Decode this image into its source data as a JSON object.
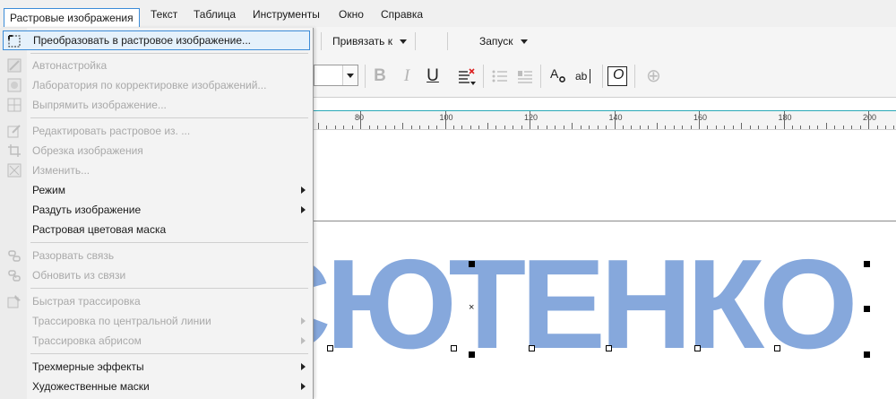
{
  "menubar": {
    "items": [
      {
        "label": "Растровые изображения",
        "active": true
      },
      {
        "label": "Текст",
        "active": false
      },
      {
        "label": "Таблица",
        "active": false
      },
      {
        "label": "Инструменты",
        "active": false
      },
      {
        "label": "Окно",
        "active": false
      },
      {
        "label": "Справка",
        "active": false
      }
    ]
  },
  "toolbar": {
    "snap_label": "Привязать к",
    "launch_label": "Запуск",
    "bold": "B",
    "italic": "I",
    "underline": "U",
    "char_format": "A",
    "edit_text": "ab",
    "overprint": "O",
    "add": "⊕"
  },
  "ruler": {
    "labels": [
      "80",
      "100",
      "120",
      "140",
      "160",
      "180",
      "200"
    ]
  },
  "canvas": {
    "text": "СЮТЕНКО"
  },
  "dropdown": {
    "items": [
      {
        "label": "Преобразовать в растровое изображение...",
        "enabled": true,
        "highlight": true,
        "submenu": false,
        "icon": "convert-bitmap-icon"
      },
      {
        "label": "Автонастройка",
        "enabled": false,
        "submenu": false,
        "icon": "auto-adjust-icon"
      },
      {
        "label": "Лаборатория по корректировке изображений...",
        "enabled": false,
        "submenu": false,
        "icon": "image-adjust-lab-icon"
      },
      {
        "label": "Выпрямить изображение...",
        "enabled": false,
        "submenu": false,
        "icon": "straighten-icon"
      },
      {
        "label": "Редактировать растровое из. ...",
        "enabled": false,
        "submenu": false,
        "icon": "edit-bitmap-icon"
      },
      {
        "label": "Обрезка изображения",
        "enabled": false,
        "submenu": false,
        "icon": "crop-icon"
      },
      {
        "label": "Изменить...",
        "enabled": false,
        "submenu": false,
        "icon": "resample-icon"
      },
      {
        "label": "Режим",
        "enabled": true,
        "submenu": true,
        "icon": ""
      },
      {
        "label": "Раздуть изображение",
        "enabled": true,
        "submenu": true,
        "icon": ""
      },
      {
        "label": "Растровая цветовая маска",
        "enabled": true,
        "submenu": false,
        "icon": ""
      },
      {
        "label": "Разорвать связь",
        "enabled": false,
        "submenu": false,
        "icon": "break-link-icon"
      },
      {
        "label": "Обновить из связи",
        "enabled": false,
        "submenu": false,
        "icon": "update-link-icon"
      },
      {
        "label": "Быстрая трассировка",
        "enabled": false,
        "submenu": false,
        "icon": "quick-trace-icon"
      },
      {
        "label": "Трассировка по центральной линии",
        "enabled": false,
        "submenu": true,
        "icon": ""
      },
      {
        "label": "Трассировка абрисом",
        "enabled": false,
        "submenu": true,
        "icon": ""
      },
      {
        "label": "Трехмерные эффекты",
        "enabled": true,
        "submenu": true,
        "icon": ""
      },
      {
        "label": "Художественные маски",
        "enabled": true,
        "submenu": true,
        "icon": ""
      }
    ]
  },
  "colors": {
    "accent": "#3c8cd8",
    "text_fill": "#86a8dc",
    "disabled_text": "#a9a9a9",
    "ruler_line": "#2aa8b8"
  }
}
